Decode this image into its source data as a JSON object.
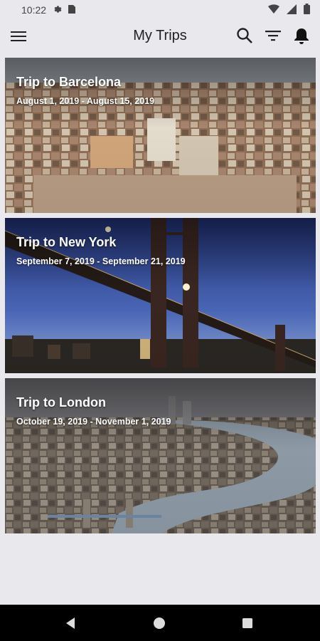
{
  "status": {
    "time": "10:22"
  },
  "app_bar": {
    "title": "My Trips",
    "icons": [
      "menu-icon",
      "search-icon",
      "filter-icon",
      "bell-icon"
    ]
  },
  "trips": [
    {
      "title": "Trip to Barcelona",
      "dates": "August 1, 2019 - August 15, 2019"
    },
    {
      "title": "Trip to New York",
      "dates": "September 7, 2019 - September 21, 2019"
    },
    {
      "title": "Trip to London",
      "dates": "October 19, 2019 - November 1, 2019"
    }
  ],
  "navigation": {
    "icons": [
      "back-icon",
      "home-icon",
      "recents-icon"
    ]
  },
  "colors": {
    "background": "#e9e8ed",
    "app_bar_text": "#222222",
    "nav_bar": "#000000"
  }
}
